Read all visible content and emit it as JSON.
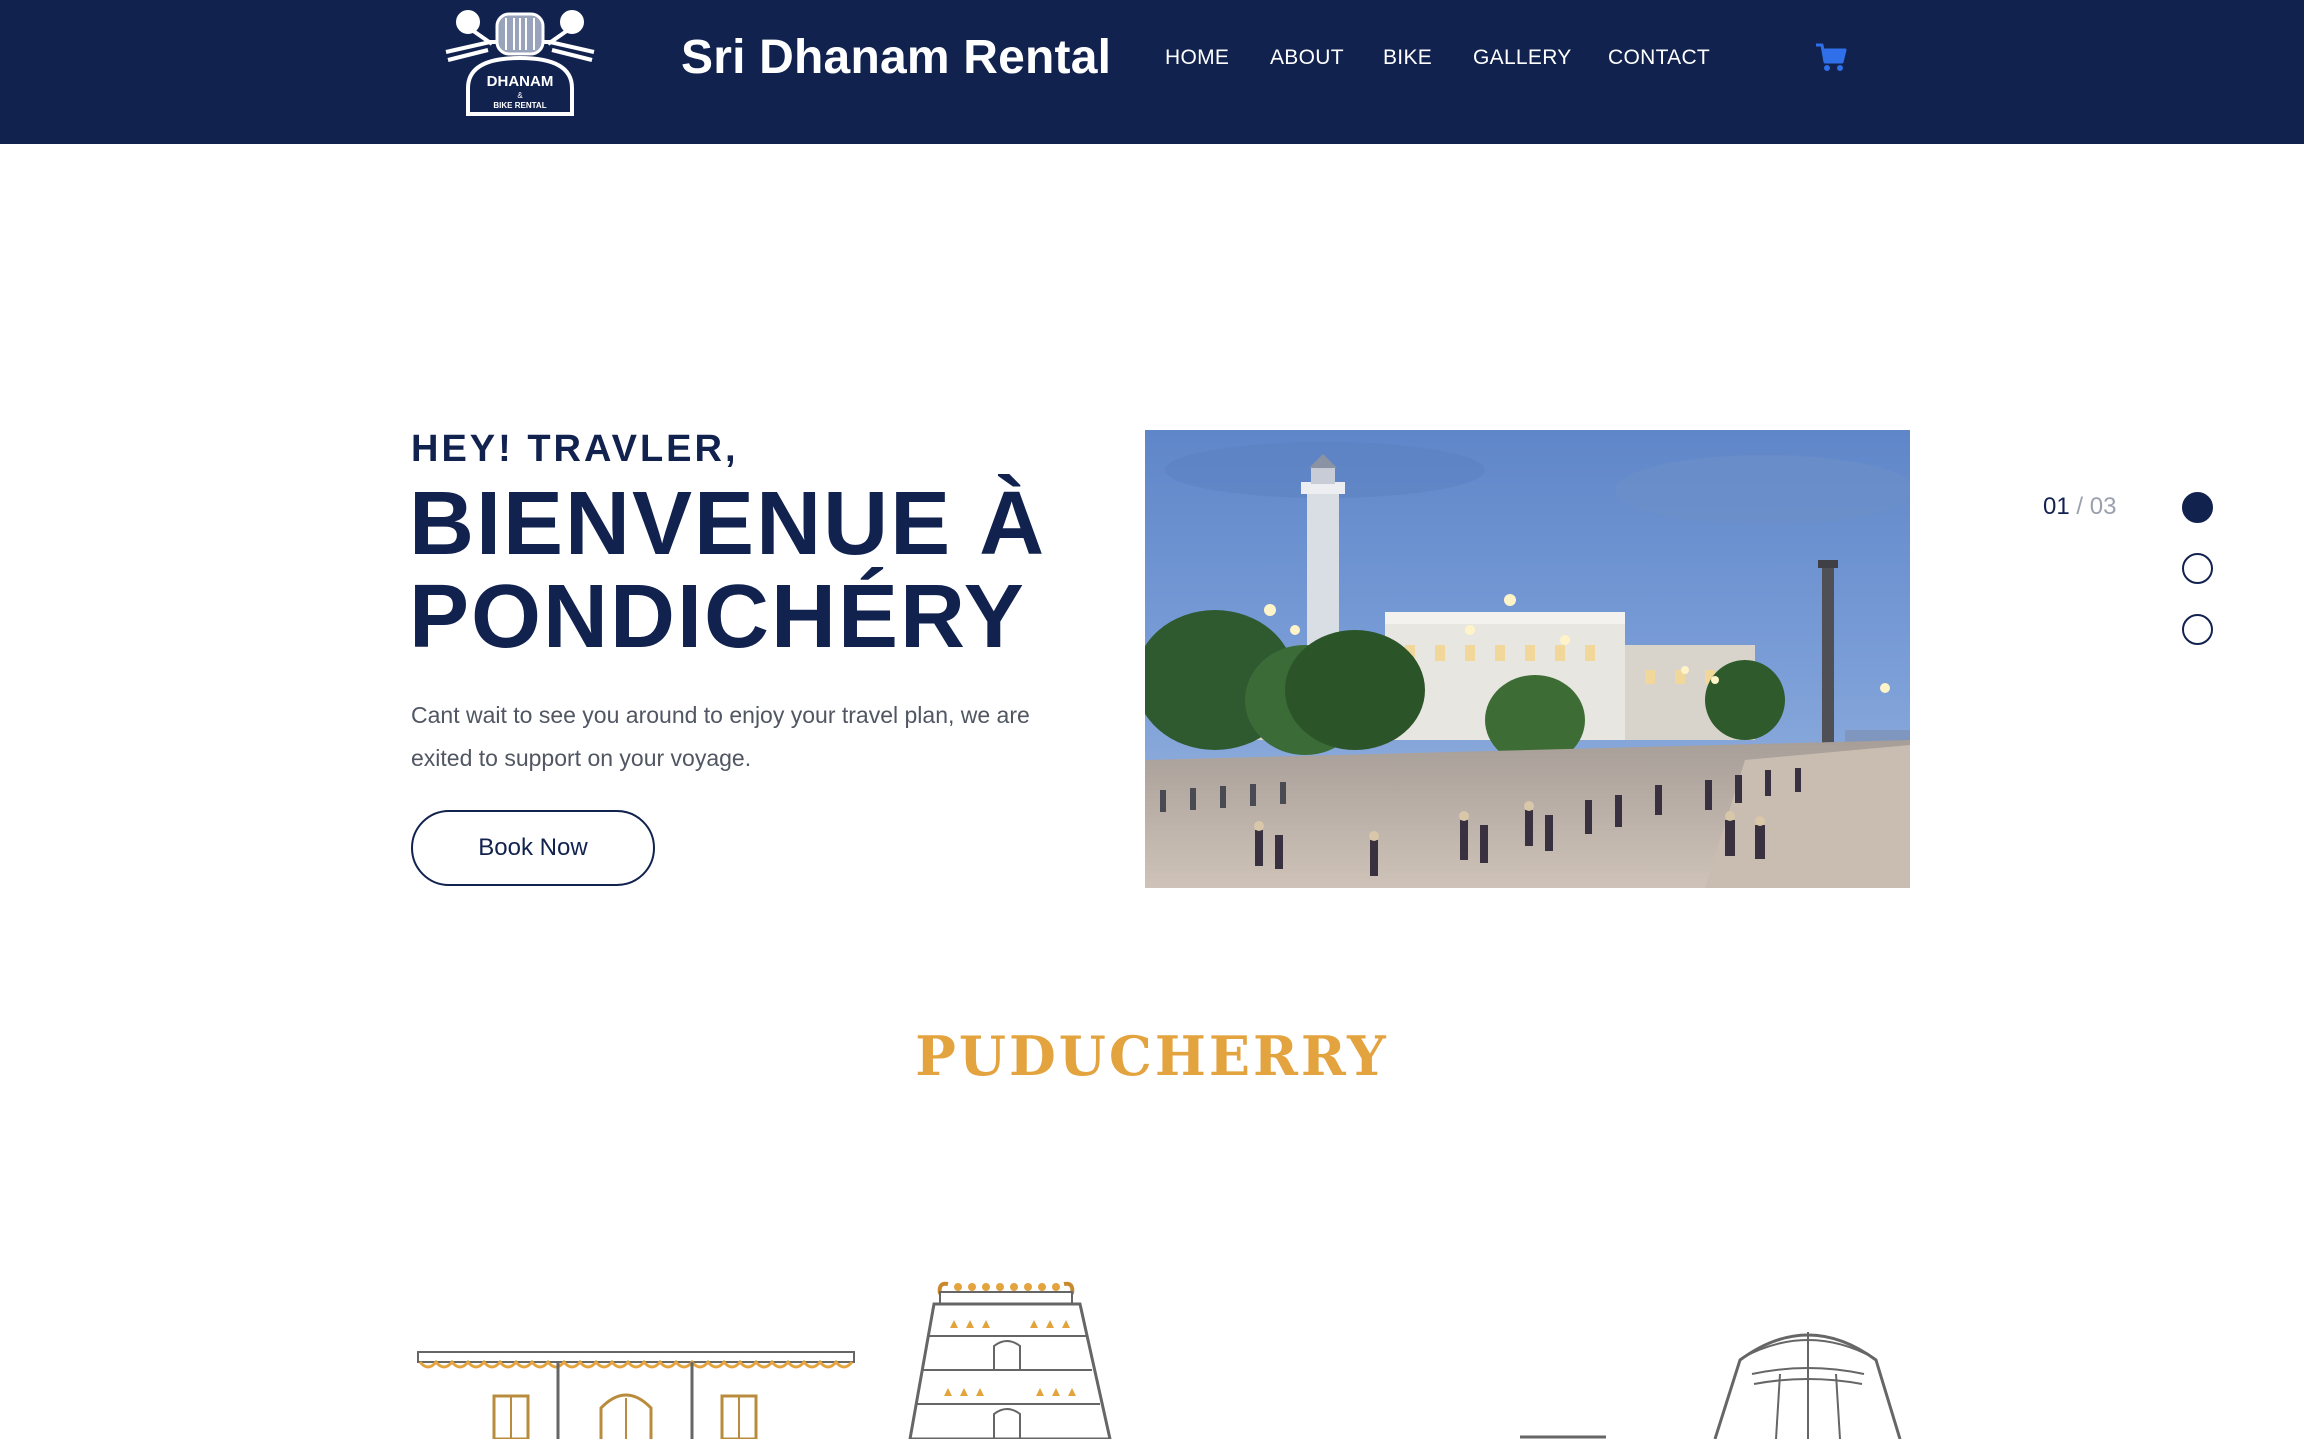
{
  "brand": {
    "logo_text_top": "DHANAM",
    "logo_text_mid": "&",
    "logo_text_bottom": "BIKE RENTAL",
    "name": "Sri Dhanam Rental"
  },
  "nav": {
    "items": [
      {
        "label": "HOME"
      },
      {
        "label": "ABOUT"
      },
      {
        "label": "BIKE"
      },
      {
        "label": "GALLERY"
      },
      {
        "label": "CONTACT"
      }
    ],
    "cart_icon": "shopping-cart-icon"
  },
  "hero": {
    "eyebrow": "HEY! TRAVLER,",
    "title_line1": "BIENVENUE À",
    "title_line2": "PONDICHÉRY",
    "description": "Cant wait to see you around to enjoy your travel plan, we are exited to support on your voyage.",
    "cta_label": "Book Now"
  },
  "slider": {
    "current": "01",
    "separator": " / ",
    "total": "03",
    "active_index": 0
  },
  "section": {
    "title": "PUDUCHERRY"
  },
  "colors": {
    "navy": "#11224f",
    "gold": "#e3a33f",
    "cart_blue": "#2f6fea",
    "text_gray": "#505662"
  }
}
